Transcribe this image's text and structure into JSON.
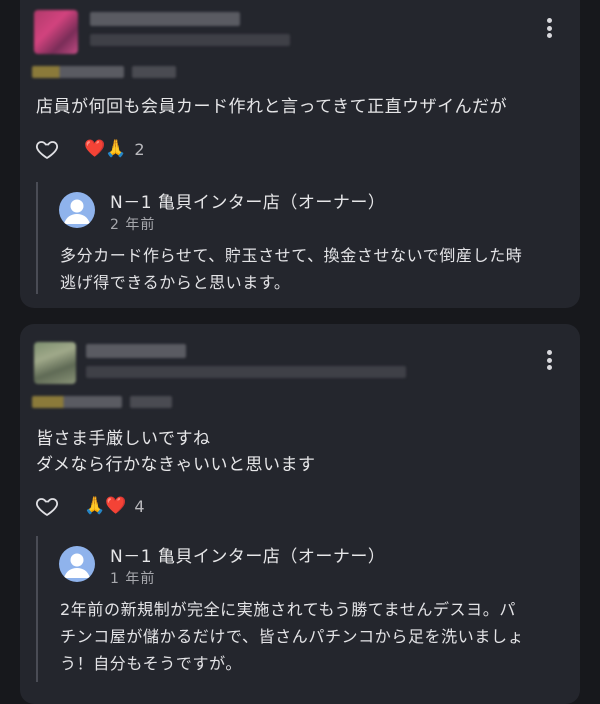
{
  "reviews": [
    {
      "text_lines": [
        "店員が何回も会員カード作れと言ってきて正直ウザイんだが"
      ],
      "reaction_emojis": "❤️🙏",
      "reaction_count": "2",
      "reply": {
        "owner_name": "N－1 亀貝インター店（オーナー）",
        "date": "2 年前",
        "text_lines": [
          "多分カード作らせて、貯玉させて、換金させないで倒産した時",
          "逃げ得できるからと思います。"
        ]
      }
    },
    {
      "text_lines": [
        "皆さま手厳しいですね",
        "ダメなら行かなきゃいいと思います"
      ],
      "reaction_emojis": "🙏❤️",
      "reaction_count": "4",
      "reply": {
        "owner_name": "N－1 亀貝インター店（オーナー）",
        "date": "1 年前",
        "text_lines": [
          "2年前の新規制が完全に実施されてもう勝てませんデスヨ。パ",
          "チンコ屋が儲かるだけで、皆さんパチンコから足を洗いましょ",
          "う！自分もそうですが。"
        ]
      }
    }
  ],
  "icons": {
    "like": "heart-outline-icon",
    "more": "more-vert-icon",
    "avatar": "person-avatar-icon"
  },
  "colors": {
    "background": "#17181c",
    "card": "#24262d",
    "avatar": "#8fb3ec"
  }
}
